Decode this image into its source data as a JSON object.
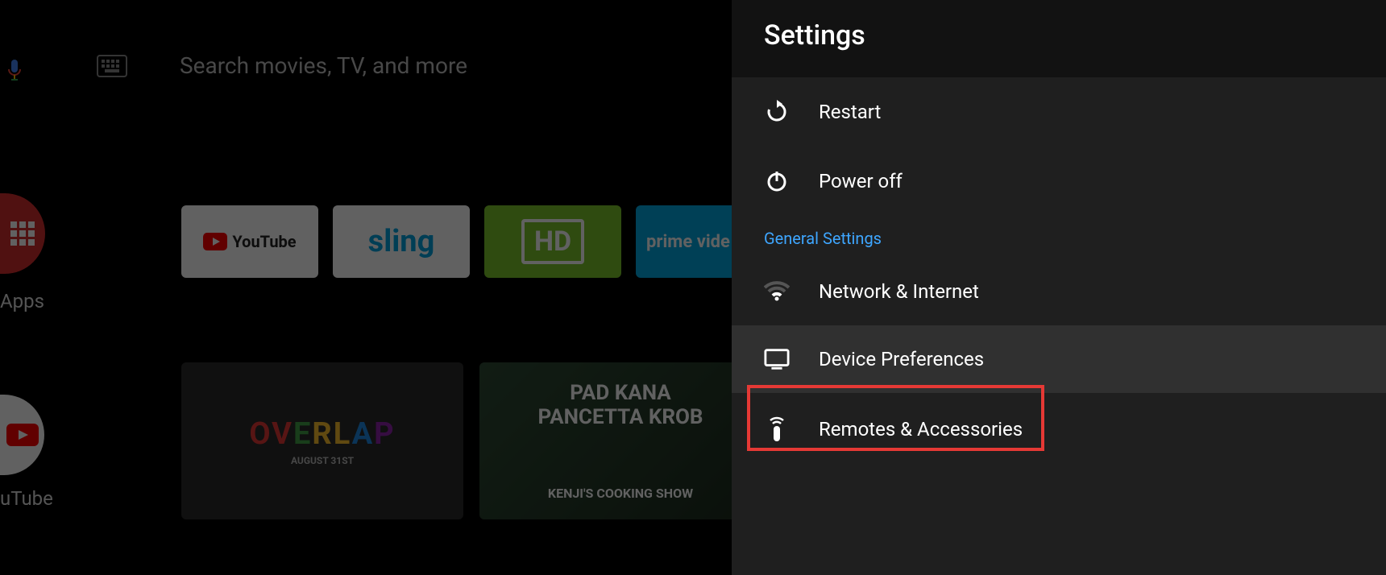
{
  "search": {
    "placeholder": "Search movies, TV, and more"
  },
  "apps_row": {
    "label": "Apps",
    "cards": {
      "youtube": "YouTube",
      "sling": "sling",
      "hd": "HD",
      "prime": "prime vide"
    }
  },
  "left_tiles": {
    "youtube": "uTube"
  },
  "content_row": {
    "overlap": {
      "word": "OVERLAP",
      "sub": "AUGUST 31ST"
    },
    "kenji": {
      "line1": "PAD KANA",
      "line2": "PANCETTA KROB",
      "line3": "KENJI'S COOKING SHOW"
    }
  },
  "panel": {
    "title": "Settings",
    "items": {
      "restart": "Restart",
      "poweroff": "Power off",
      "network": "Network & Internet",
      "device": "Device Preferences",
      "remotes": "Remotes & Accessories"
    },
    "section": "General Settings"
  }
}
